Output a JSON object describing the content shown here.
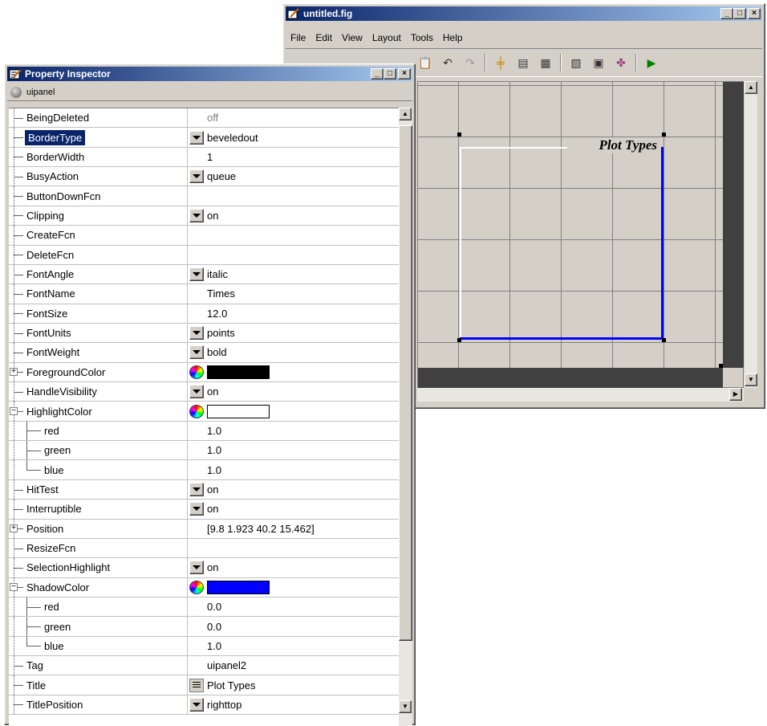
{
  "figure_window": {
    "title": "untitled.fig",
    "menu": [
      "File",
      "Edit",
      "View",
      "Layout",
      "Tools",
      "Help"
    ],
    "menu_accel": [
      "F",
      "E",
      "V",
      "L",
      "T",
      "H"
    ],
    "panel_title": "Plot Types",
    "panel_colors": {
      "highlight": "#ffffff",
      "shadow": "#0000ff"
    }
  },
  "inspector": {
    "title": "Property Inspector",
    "object_label": "uipanel",
    "rows": [
      {
        "name": "BeingDeleted",
        "value": "off",
        "kind": "text-gray"
      },
      {
        "name": "BorderType",
        "value": "beveledout",
        "kind": "dropdown",
        "selected": true
      },
      {
        "name": "BorderWidth",
        "value": "1",
        "kind": "text"
      },
      {
        "name": "BusyAction",
        "value": "queue",
        "kind": "dropdown"
      },
      {
        "name": "ButtonDownFcn",
        "value": "",
        "kind": "text"
      },
      {
        "name": "Clipping",
        "value": "on",
        "kind": "dropdown"
      },
      {
        "name": "CreateFcn",
        "value": "",
        "kind": "text"
      },
      {
        "name": "DeleteFcn",
        "value": "",
        "kind": "text"
      },
      {
        "name": "FontAngle",
        "value": "italic",
        "kind": "dropdown"
      },
      {
        "name": "FontName",
        "value": "Times",
        "kind": "text"
      },
      {
        "name": "FontSize",
        "value": "12.0",
        "kind": "text"
      },
      {
        "name": "FontUnits",
        "value": "points",
        "kind": "dropdown"
      },
      {
        "name": "FontWeight",
        "value": "bold",
        "kind": "dropdown"
      },
      {
        "name": "ForegroundColor",
        "value": "",
        "kind": "color",
        "color": "#000000",
        "expand": "+"
      },
      {
        "name": "HandleVisibility",
        "value": "on",
        "kind": "dropdown"
      },
      {
        "name": "HighlightColor",
        "value": "",
        "kind": "color",
        "color": "#ffffff",
        "expand": "-"
      },
      {
        "name": "red",
        "value": "1.0",
        "kind": "text",
        "child": true
      },
      {
        "name": "green",
        "value": "1.0",
        "kind": "text",
        "child": true
      },
      {
        "name": "blue",
        "value": "1.0",
        "kind": "text",
        "child": true,
        "last": true
      },
      {
        "name": "HitTest",
        "value": "on",
        "kind": "dropdown"
      },
      {
        "name": "Interruptible",
        "value": "on",
        "kind": "dropdown"
      },
      {
        "name": "Position",
        "value": "[9.8 1.923 40.2 15.462]",
        "kind": "text",
        "expand": "+"
      },
      {
        "name": "ResizeFcn",
        "value": "",
        "kind": "text"
      },
      {
        "name": "SelectionHighlight",
        "value": "on",
        "kind": "dropdown"
      },
      {
        "name": "ShadowColor",
        "value": "",
        "kind": "color",
        "color": "#0000ff",
        "expand": "-"
      },
      {
        "name": "red",
        "value": "0.0",
        "kind": "text",
        "child": true
      },
      {
        "name": "green",
        "value": "0.0",
        "kind": "text",
        "child": true
      },
      {
        "name": "blue",
        "value": "1.0",
        "kind": "text",
        "child": true,
        "last": true
      },
      {
        "name": "Tag",
        "value": "uipanel2",
        "kind": "text"
      },
      {
        "name": "Title",
        "value": "Plot Types",
        "kind": "textedit"
      },
      {
        "name": "TitlePosition",
        "value": "righttop",
        "kind": "dropdown"
      }
    ]
  },
  "colors": {
    "selection": "#0a246a",
    "title_gradient_start": "#0a246a",
    "title_gradient_end": "#a6caf0"
  }
}
